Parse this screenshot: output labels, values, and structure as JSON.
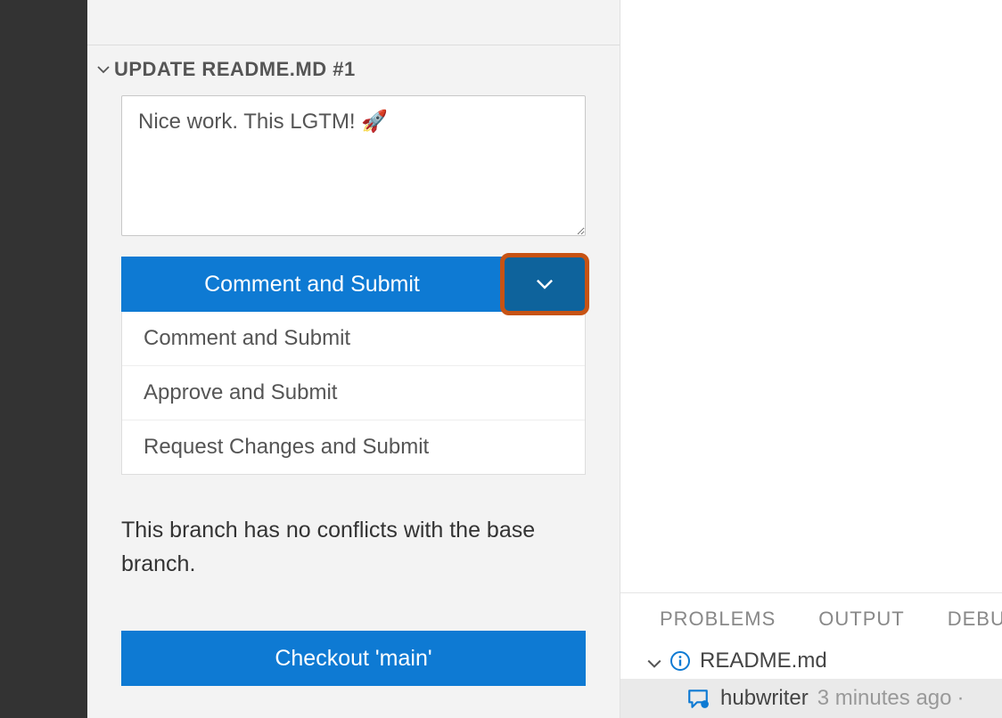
{
  "section": {
    "title": "UPDATE README.MD #1"
  },
  "review": {
    "comment": "Nice work. This LGTM! 🚀",
    "primary_label": "Comment and Submit",
    "options": [
      "Comment and Submit",
      "Approve and Submit",
      "Request Changes and Submit"
    ],
    "status_text": "This branch has no conflicts with the base branch.",
    "checkout_label": "Checkout 'main'"
  },
  "bottom_tabs": [
    "PROBLEMS",
    "OUTPUT",
    "DEBUG"
  ],
  "comments_tree": {
    "file": "README.md",
    "author": "hubwriter",
    "time": "3 minutes ago"
  }
}
